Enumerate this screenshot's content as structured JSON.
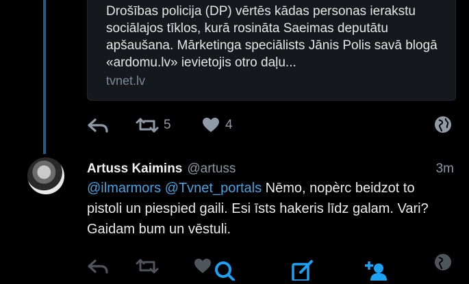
{
  "link_card": {
    "text": "Drošības policija (DP) vērtēs kādas personas ierakstu sociālajos tīklos, kurā rosināta Saeimas deputātu apšaušana. Mārketinga speciālists Jānis Polis savā blogā «ardomu.lv» ievietojis otro daļu...",
    "domain": "tvnet.lv"
  },
  "first_tweet_actions": {
    "retweet_count": "5",
    "like_count": "4"
  },
  "reply_tweet": {
    "author_name": "Artuss Kaimins",
    "author_handle": "@artuss",
    "time": "3m",
    "mention_1": "@ilmarmors",
    "mention_2": "@Tvnet_portals",
    "text": " Nēmo, nopèrc beidzot to pistoli un piespied gaili. Esi īsts hakeris līdz galam. Vari? Gaidam bum un vēstuli."
  },
  "colors": {
    "background": "#000000",
    "accent": "#1da1f2",
    "mention": "#4aa3df",
    "muted": "#8b98a5"
  },
  "icons": [
    "reply-icon",
    "retweet-icon",
    "like-icon",
    "globe-icon",
    "search-icon",
    "compose-icon",
    "add-user-icon"
  ]
}
